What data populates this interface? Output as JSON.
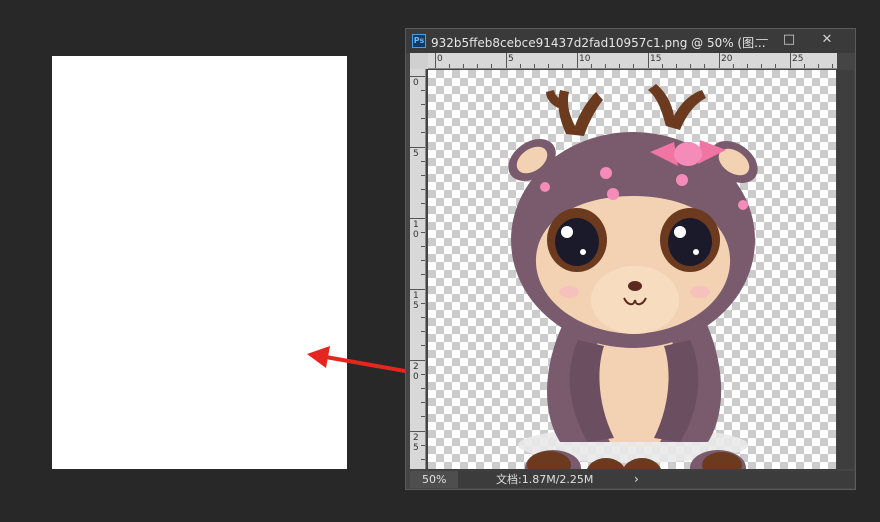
{
  "document": {
    "title": "932b5ffeb8cebce91437d2fad10957c1.png @ 50% (图..."
  },
  "window_controls": {
    "minimize": "—",
    "maximize": "□",
    "close": "✕"
  },
  "app_badge": "Ps",
  "ruler": {
    "top_ticks": [
      "0",
      "5",
      "10",
      "15",
      "20",
      "25"
    ],
    "left_ticks": [
      "0",
      "5",
      "10",
      "15",
      "20",
      "25"
    ]
  },
  "status": {
    "zoom": "50%",
    "doc_size": "文档:1.87M/2.25M",
    "more": "›"
  },
  "colors": {
    "workspace": "#282828",
    "arrow": "#e5261e",
    "plush_body": "#7a5b6e",
    "plush_face": "#f3d2b3",
    "antler": "#6b3a1f"
  }
}
